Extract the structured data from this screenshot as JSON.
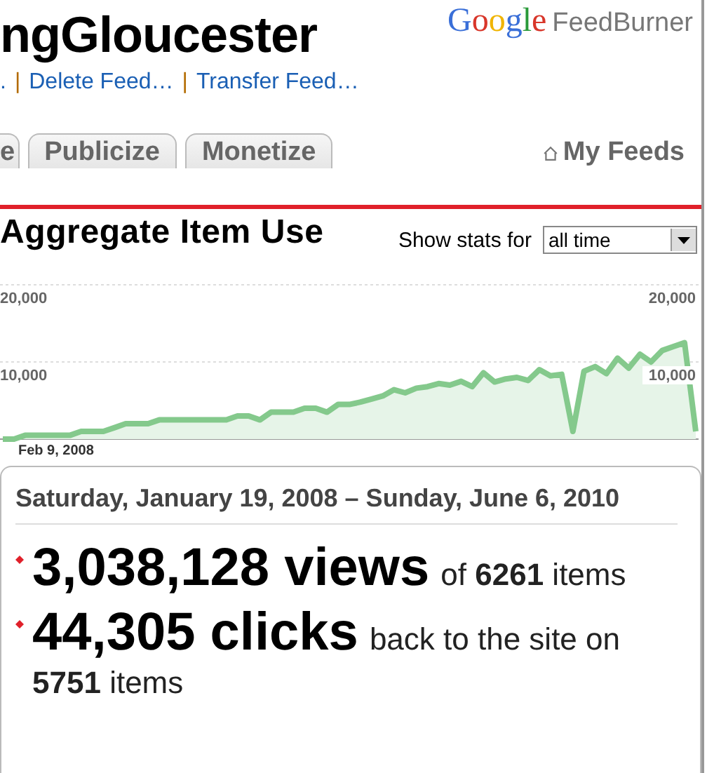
{
  "header": {
    "title": "ngGloucester",
    "logo": {
      "brand": "Google",
      "product": "FeedBurner"
    }
  },
  "feed_links": {
    "separator": "|",
    "items": [
      ".",
      "Delete Feed…",
      "Transfer Feed…"
    ]
  },
  "tabs": [
    {
      "label": "e",
      "selected": false
    },
    {
      "label": "Publicize",
      "selected": false
    },
    {
      "label": "Monetize",
      "selected": false
    }
  ],
  "my_feeds": "My Feeds",
  "section": {
    "title": "Aggregate Item Use",
    "stats_label": "Show stats for",
    "stats_select": "all time"
  },
  "chart": {
    "chart_data": {
      "type": "area",
      "xlabel": "Feb 9, 2008",
      "ylim": [
        0,
        20000
      ],
      "yticks": [
        {
          "value": 10000,
          "label": "10,000"
        },
        {
          "value": 20000,
          "label": "20,000"
        }
      ],
      "series": [
        {
          "color": "#84c98c",
          "values": [
            0,
            0,
            500,
            500,
            500,
            500,
            500,
            1000,
            1000,
            1000,
            1500,
            2000,
            2000,
            2000,
            2500,
            2500,
            2500,
            2500,
            2500,
            2500,
            2500,
            3000,
            3000,
            2500,
            3500,
            3500,
            3500,
            4000,
            4000,
            3500,
            4500,
            4500,
            4800,
            5200,
            5600,
            6400,
            6000,
            6600,
            6800,
            7200,
            7000,
            7500,
            6800,
            8600,
            7400,
            7800,
            8000,
            7600,
            9000,
            8200,
            8400,
            1000,
            8800,
            9400,
            8500,
            10500,
            9200,
            11000,
            10000,
            11500,
            12000,
            12500,
            1000
          ]
        }
      ]
    }
  },
  "summary": {
    "date_range": "Saturday, January 19, 2008 – Sunday, June 6, 2010",
    "stats": [
      {
        "figure": "3,038,128 views",
        "detail": "of **6261** items"
      },
      {
        "figure": "44,305 clicks",
        "detail": "back to the site on **5751** items"
      }
    ]
  }
}
